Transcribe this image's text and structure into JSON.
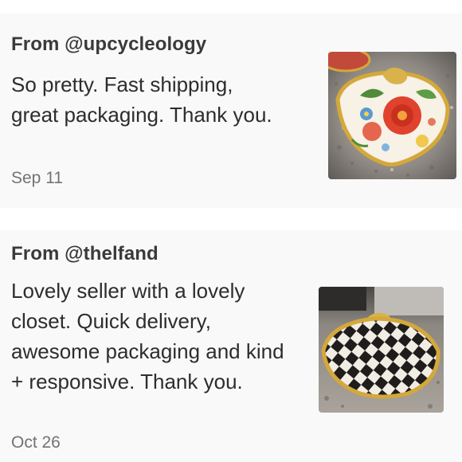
{
  "reviews": [
    {
      "from": "From @upcycleology",
      "text": "So pretty. Fast shipping, great packaging. Thank you.",
      "date": "Sep 11",
      "thumbnail": "floral-shell-trinket-dish-photo"
    },
    {
      "from": "From @thelfand",
      "text": "Lovely seller with a lovely closet. Quick delivery, awesome packaging and kind + responsive. Thank you.",
      "date": "Oct 26",
      "thumbnail": "checkered-shell-trinket-dish-photo"
    }
  ],
  "colors": {
    "background": "#f9f9f9",
    "separator": "#ffffff",
    "author": "#3a3a3a",
    "body": "#2d2d2d",
    "date": "#737373",
    "gold": "#d4a83a"
  }
}
